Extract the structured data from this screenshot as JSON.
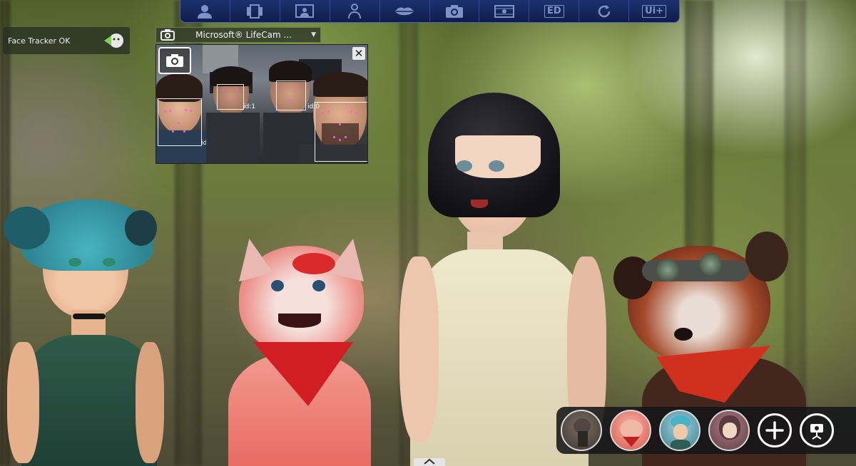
{
  "toolbar": {
    "buttons": [
      {
        "id": "avatar",
        "icon": "person-icon"
      },
      {
        "id": "scene",
        "icon": "film-strip-icon"
      },
      {
        "id": "screen",
        "icon": "monitor-person-icon"
      },
      {
        "id": "body",
        "icon": "rig-figure-icon"
      },
      {
        "id": "lips",
        "icon": "lips-icon"
      },
      {
        "id": "snapshot",
        "icon": "camera-icon"
      },
      {
        "id": "record",
        "icon": "filmstrip-record-icon"
      },
      {
        "id": "ed",
        "icon": "ed-panel-icon",
        "label": "ED"
      },
      {
        "id": "reset",
        "icon": "refresh-icon"
      },
      {
        "id": "ui_plus",
        "icon": "ui-plus-icon",
        "label": "Ui+"
      }
    ]
  },
  "tracker": {
    "status": "Face Tracker OK",
    "icon": "face-tracking-icon"
  },
  "camera": {
    "device": "Microsoft® LifeCam ...",
    "close_label": "✕",
    "faces": [
      {
        "id_label": "id:2"
      },
      {
        "id_label": "id:1"
      },
      {
        "id_label": "id:0"
      }
    ]
  },
  "avatars": [
    {
      "name": "bear-avatar",
      "color": "#6e6558"
    },
    {
      "name": "cat-avatar",
      "color": "#e96a5e"
    },
    {
      "name": "blue-hair-girl-avatar",
      "color": "#5fb9c9"
    },
    {
      "name": "dark-hair-girl-avatar",
      "color": "#6a4a55"
    }
  ],
  "colors": {
    "toolbar": "#15245a",
    "accent": "#7f92c8",
    "tracker_green": "#7fd34a"
  }
}
